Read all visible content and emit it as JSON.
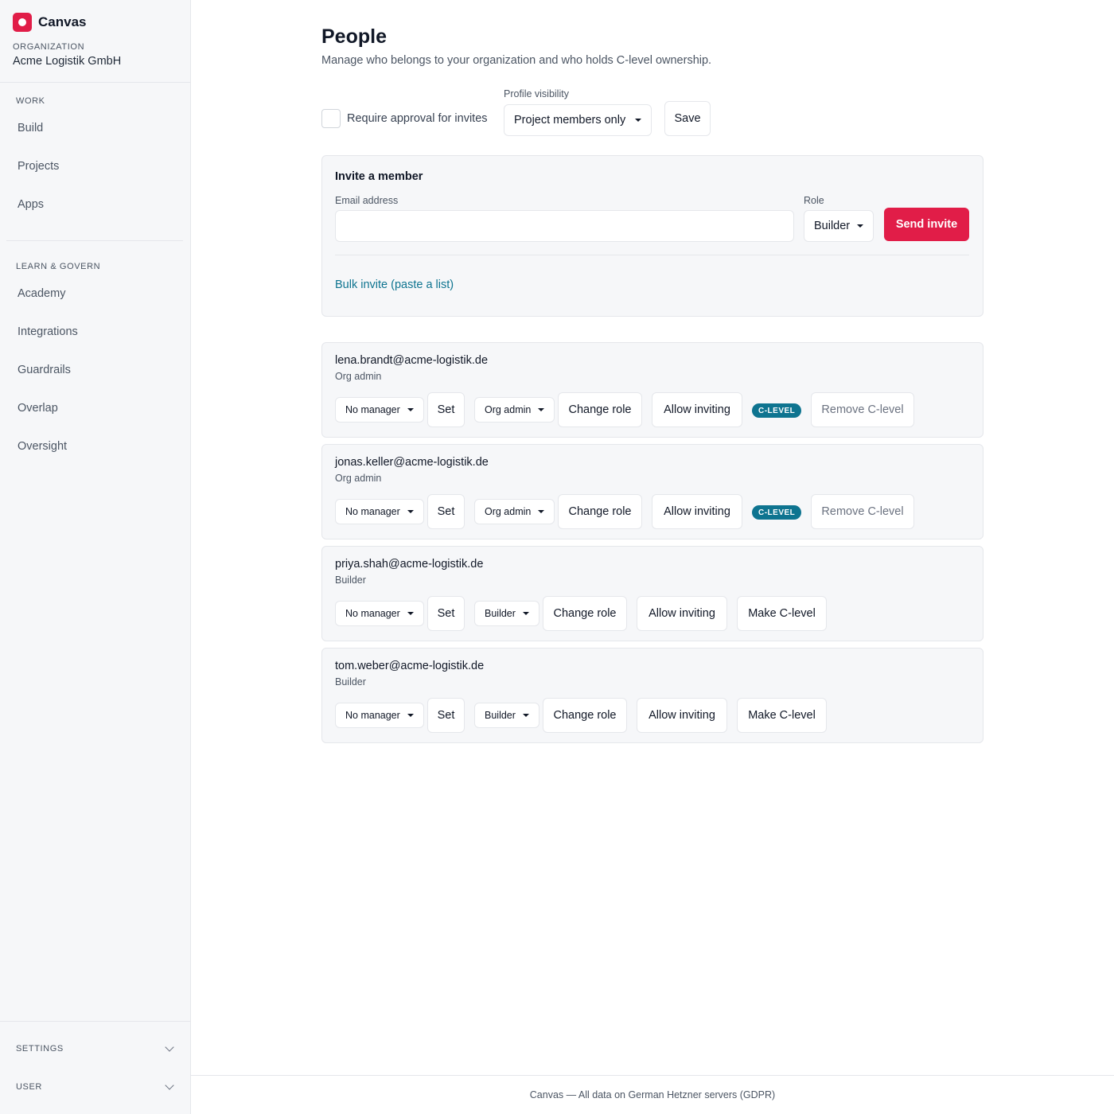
{
  "brand": {
    "name": "Canvas"
  },
  "org": {
    "caption": "ORGANIZATION",
    "name": "Acme Logistik GmbH"
  },
  "sidebar": {
    "work_section": "WORK",
    "work_items": [
      {
        "label": "Build"
      },
      {
        "label": "Projects"
      },
      {
        "label": "Apps"
      }
    ],
    "learn_section": "LEARN & GOVERN",
    "learn_items": [
      {
        "label": "Academy"
      },
      {
        "label": "Integrations"
      },
      {
        "label": "Guardrails"
      },
      {
        "label": "Overlap"
      },
      {
        "label": "Oversight"
      }
    ],
    "settings_label": "SETTINGS",
    "user_label": "USER"
  },
  "page": {
    "title": "People",
    "subtitle": "Manage who belongs to your organization and who holds C-level ownership."
  },
  "settings_bar": {
    "approval_label": "Require approval for invites",
    "approval_checked": false,
    "visibility_caption": "Profile visibility",
    "visibility_value": "Project members only",
    "save_label": "Save"
  },
  "invite": {
    "title": "Invite a member",
    "email_label": "Email address",
    "email_value": "",
    "role_label": "Role",
    "role_value": "Builder",
    "send_label": "Send invite",
    "bulk_label": "Bulk invite (paste a list)"
  },
  "members": [
    {
      "email": "lena.brandt@acme-logistik.de",
      "role": "Org admin",
      "manager_value": "No manager",
      "set_label": "Set",
      "role_select_value": "Org admin",
      "change_role_label": "Change role",
      "allow_inviting_label": "Allow inviting",
      "badge": "C-LEVEL",
      "clevel_action_label": "Remove C-level"
    },
    {
      "email": "jonas.keller@acme-logistik.de",
      "role": "Org admin",
      "manager_value": "No manager",
      "set_label": "Set",
      "role_select_value": "Org admin",
      "change_role_label": "Change role",
      "allow_inviting_label": "Allow inviting",
      "badge": "C-LEVEL",
      "clevel_action_label": "Remove C-level"
    },
    {
      "email": "priya.shah@acme-logistik.de",
      "role": "Builder",
      "manager_value": "No manager",
      "set_label": "Set",
      "role_select_value": "Builder",
      "change_role_label": "Change role",
      "allow_inviting_label": "Allow inviting",
      "clevel_action_label": "Make C-level"
    },
    {
      "email": "tom.weber@acme-logistik.de",
      "role": "Builder",
      "manager_value": "No manager",
      "set_label": "Set",
      "role_select_value": "Builder",
      "change_role_label": "Change role",
      "allow_inviting_label": "Allow inviting",
      "clevel_action_label": "Make C-level"
    }
  ],
  "footer": {
    "text": "Canvas — All data on German Hetzner servers (GDPR)"
  },
  "colors": {
    "accent": "#e11d48",
    "badge": "#0e7490",
    "link": "#0e7490",
    "sidebar_bg": "#f6f7f9",
    "border": "#e5e7eb"
  },
  "icons": {
    "brand": "canvas-logo",
    "caret": "caret-down-icon",
    "chevron": "chevron-down-icon"
  }
}
